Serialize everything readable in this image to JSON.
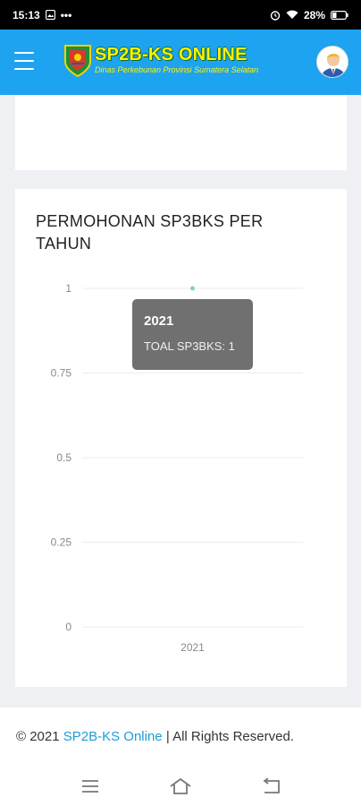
{
  "status_bar": {
    "time": "15:13",
    "battery": "28%",
    "more": "•••"
  },
  "header": {
    "title": "SP2B-KS ONLINE",
    "subtitle": "Dinas Perkebunan Provinsi Sumatera Selatan"
  },
  "chart_card": {
    "title": "PERMOHONAN SP3BKS PER TAHUN",
    "tooltip": {
      "title": "2021",
      "body": "TOAL SP3BKS: 1"
    }
  },
  "chart_data": {
    "type": "line",
    "title": "PERMOHONAN SP3BKS PER TAHUN",
    "categories": [
      "2021"
    ],
    "series": [
      {
        "name": "TOAL SP3BKS",
        "values": [
          1
        ]
      }
    ],
    "ylim": [
      0,
      1
    ],
    "yticks": [
      "0",
      "0.25",
      "0.5",
      "0.75",
      "1"
    ],
    "grid": true,
    "color": "#7fd3c4"
  },
  "footer": {
    "copyright": "© 2021",
    "link": "SP2B-KS Online",
    "rest": "| All Rights Reserved."
  },
  "colors": {
    "header_bg": "#1ea3f0",
    "brand_text": "#fff200",
    "link": "#1e9bd7"
  },
  "icons": {
    "menu": "hamburger-icon",
    "avatar": "user-avatar",
    "nav": [
      "recent-apps-icon",
      "home-icon",
      "back-icon"
    ]
  }
}
